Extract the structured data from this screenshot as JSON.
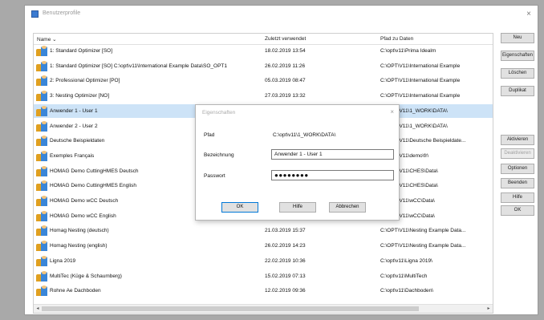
{
  "window": {
    "title": "Benutzerprofile",
    "close": "×"
  },
  "columns": {
    "name": "Name ⌄",
    "date": "Zuletzt verwendet",
    "path": "Pfad zu Daten"
  },
  "rows": [
    {
      "name": "1: Standard Optimizer [SO]",
      "date": "18.02.2019 13:54",
      "path": "C:\\opt\\v11\\Prima Idealm"
    },
    {
      "name": "1: Standard Optimizer [SO] C:\\opt\\v11\\International Example Data\\SO_OPT1",
      "date": "26.02.2019 11:26",
      "path": "C:\\OPT\\V11\\International Example"
    },
    {
      "name": "2: Professional Optimizer [PO]",
      "date": "05.03.2019 08:47",
      "path": "C:\\OPT\\V11\\International Example"
    },
    {
      "name": "3: Nesting Optimizer [NO]",
      "date": "27.03.2019 13:32",
      "path": "C:\\OPT\\V11\\International Example"
    },
    {
      "name": "Anwender 1 - User 1",
      "date": "",
      "path": "C:\\OPT\\V11\\1_WORK\\DATA\\"
    },
    {
      "name": "Anwender 2 - User 2",
      "date": "",
      "path": "C:\\OPT\\V11\\1_WORK\\DATA\\"
    },
    {
      "name": "Deutsche Beispieldaten",
      "date": "",
      "path": "C:\\OPT\\V11\\Deutsche Beispieldate..."
    },
    {
      "name": "Exemples Français",
      "date": "",
      "path": "C:\\OPT\\V11\\demo\\fr\\"
    },
    {
      "name": "HOMAG Demo CuttingHMES Deutsch",
      "date": "",
      "path": "C:\\OPT\\V11\\CHES\\Data\\"
    },
    {
      "name": "HOMAG Demo CuttingHMES English",
      "date": "",
      "path": "C:\\OPT\\V11\\CHES\\Data\\"
    },
    {
      "name": "HOMAG Demo wCC Deutsch",
      "date": "",
      "path": "C:\\OPT\\V11\\wCC\\Data\\"
    },
    {
      "name": "HOMAG Demo wCC English",
      "date": "",
      "path": "C:\\OPT\\V11\\wCC\\Data\\"
    },
    {
      "name": "Homag Nesting (deutsch)",
      "date": "21.03.2019 15:37",
      "path": "C:\\OPT\\V11\\Nesting Example Data..."
    },
    {
      "name": "Homag Nesting (english)",
      "date": "26.02.2019 14:23",
      "path": "C:\\OPT\\V11\\Nesting Example Data..."
    },
    {
      "name": "Ligna 2019",
      "date": "22.02.2019 10:36",
      "path": "C:\\opt\\v11\\Ligna 2019\\"
    },
    {
      "name": "MultiTec (Küge & Schaumberg)",
      "date": "15.02.2019 07:13",
      "path": "C:\\opt\\v11\\MultiTech"
    },
    {
      "name": "Rohne Ae Dachboden",
      "date": "12.02.2019 09:36",
      "path": "C:\\opt\\v11\\Dachboden\\"
    }
  ],
  "buttons": {
    "new": "Neu",
    "properties": "Eigenschaften",
    "delete": "Löschen",
    "duplicate": "Duplikat",
    "activate": "Aktivieren",
    "deactivate": "Deaktivieren",
    "options": "Optionen",
    "close": "Beenden",
    "help": "Hilfe",
    "ok": "OK"
  },
  "dialog": {
    "title": "Eigenschaften",
    "close": "×",
    "path_label": "Pfad",
    "path_value": "C:\\opt\\v11\\1_WORK\\DATA\\",
    "name_label": "Bezeichnung",
    "name_value": "Anwender 1 - User 1",
    "password_label": "Passwort",
    "password_value": "●●●●●●●●",
    "ok": "OK",
    "help": "Hilfe",
    "cancel": "Abbrechen"
  },
  "scroll": {
    "left": "◂",
    "right": "▸"
  }
}
